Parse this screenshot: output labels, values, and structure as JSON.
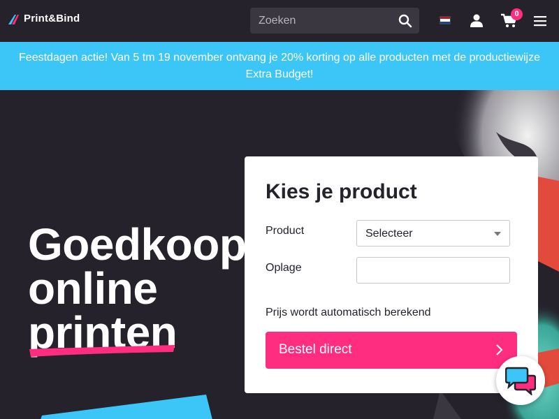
{
  "header": {
    "logo_text": "Print&Bind",
    "search_placeholder": "Zoeken",
    "cart_count": "0",
    "language": "nl"
  },
  "promo": {
    "text": "Feestdagen actie! Van 5 tm 19 november ontvang je 20% korting op alle producten met de productiewijze Extra Budget!"
  },
  "hero": {
    "title_line1": "Goedkoop",
    "title_line2": "online",
    "title_line3": "printen"
  },
  "product_card": {
    "title": "Kies je product",
    "product_label": "Product",
    "product_select_value": "Selecteer",
    "quantity_label": "Oplage",
    "quantity_value": "",
    "price_note": "Prijs wordt automatisch berekend",
    "order_button": "Bestel direct"
  },
  "colors": {
    "dark_bg": "#25222c",
    "promo_blue": "#3cc6f7",
    "accent_pink": "#ff2d7f",
    "card_white": "#ffffff"
  }
}
